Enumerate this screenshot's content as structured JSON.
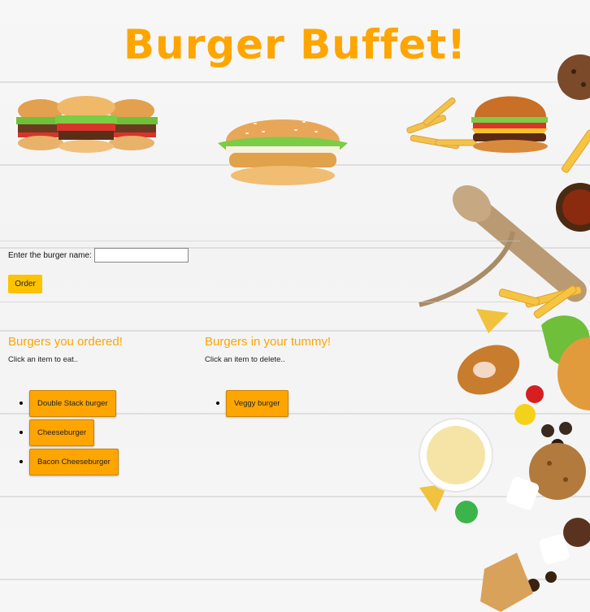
{
  "header": {
    "title": "Burger Buffet!"
  },
  "form": {
    "label": "Enter the burger name:",
    "input_value": "",
    "order_label": "Order"
  },
  "ordered": {
    "heading": "Burgers you ordered!",
    "hint": "Click an item to eat..",
    "items": [
      {
        "label": "Double Stack burger"
      },
      {
        "label": "Cheeseburger"
      },
      {
        "label": "Bacon Cheeseburger"
      }
    ]
  },
  "tummy": {
    "heading": "Burgers in your tummy!",
    "hint": "Click an item to delete..",
    "items": [
      {
        "label": "Veggy burger"
      }
    ]
  },
  "colors": {
    "accent": "#fea500",
    "order_button": "#fec200"
  }
}
